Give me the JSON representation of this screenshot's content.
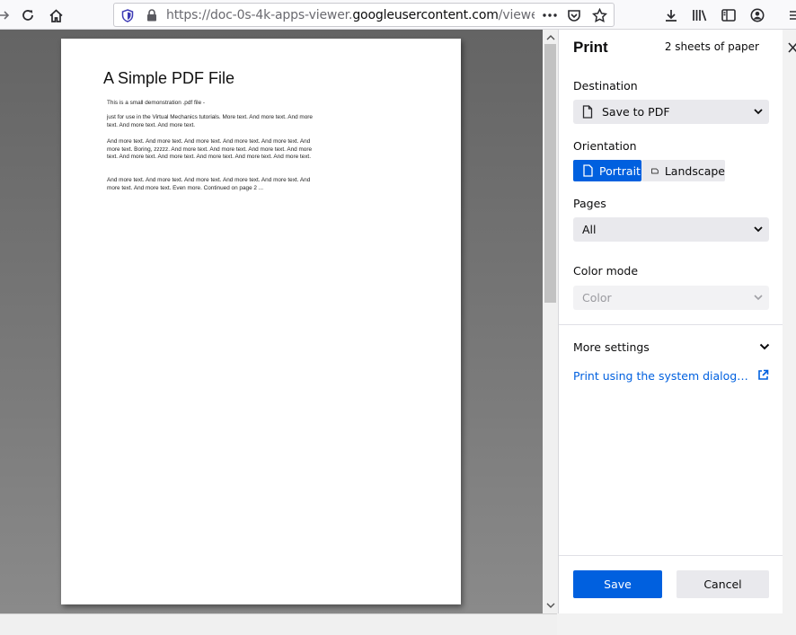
{
  "browser": {
    "url_prefix": "https://doc-0s-4k-apps-viewer.",
    "url_host": "googleusercontent.com",
    "url_suffix": "/viewer/secu"
  },
  "document": {
    "title": "A Simple PDF File",
    "paragraphs": [
      "This is a small demonstration .pdf file -",
      "just for use in the Virtual Mechanics tutorials. More text. And more text. And more text. And more text. And more text.",
      "And more text. And more text. And more text. And more text. And more text. And more text. Boring, zzzzz. And more text. And more text. And more text. And more text. And more text. And more text. And more text. And more text. And more text.",
      "And more text. And more text. And more text. And more text. And more text. And more text. And more text. Even more. Continued on page 2 ..."
    ]
  },
  "print": {
    "title": "Print",
    "sheets": "2 sheets of paper",
    "destination_label": "Destination",
    "destination_value": "Save to PDF",
    "orientation_label": "Orientation",
    "portrait_label": "Portrait",
    "landscape_label": "Landscape",
    "pages_label": "Pages",
    "pages_value": "All",
    "color_label": "Color mode",
    "color_value": "Color",
    "more_settings": "More settings",
    "system_dialog_link": "Print using the system dialog…",
    "save_label": "Save",
    "cancel_label": "Cancel"
  },
  "colors": {
    "accent": "#0060df",
    "button_gray": "#e9e9ed"
  }
}
